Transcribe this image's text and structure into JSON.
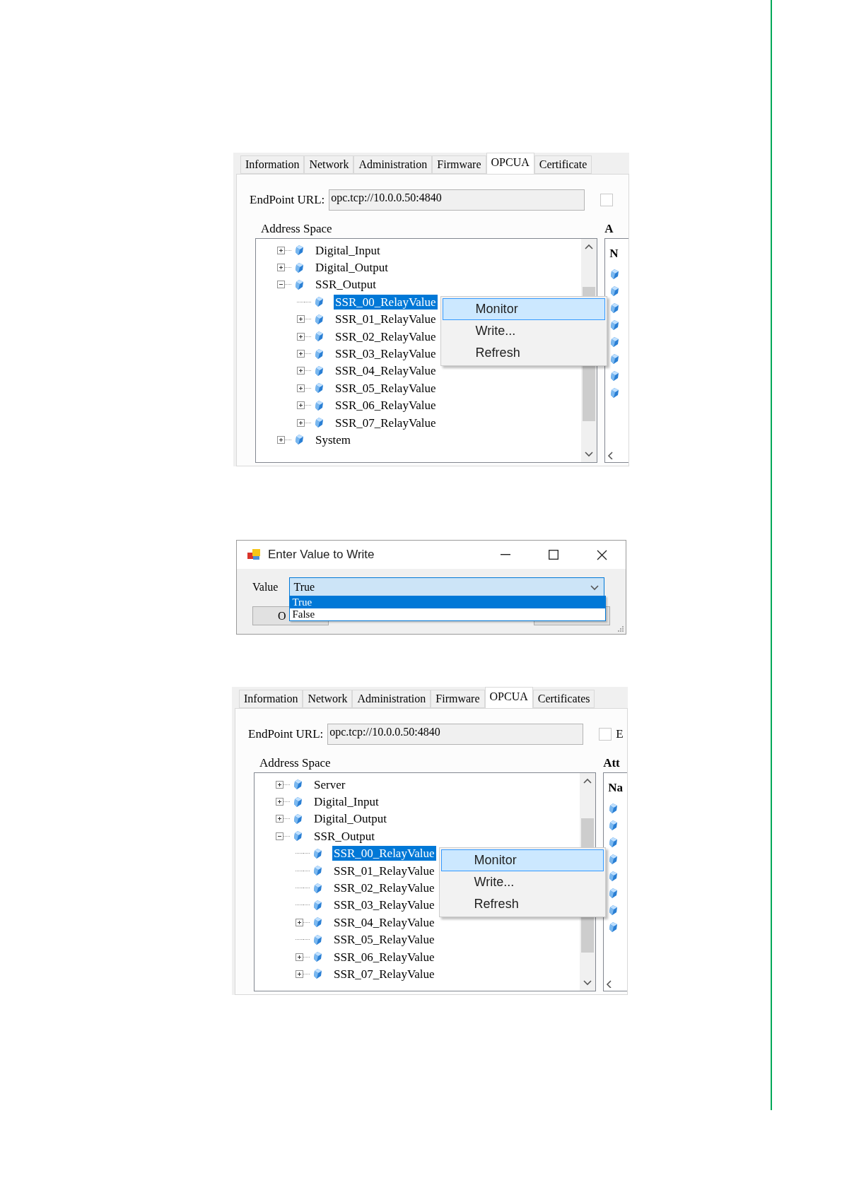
{
  "panels": [
    {
      "kind": "opcua",
      "tabs": [
        {
          "label": "Information",
          "selected": false
        },
        {
          "label": "Network",
          "selected": false
        },
        {
          "label": "Administration",
          "selected": false
        },
        {
          "label": "Firmware",
          "selected": false
        },
        {
          "label": "OPCUA",
          "selected": true
        },
        {
          "label": "Certificate",
          "selected": false
        }
      ],
      "endpoint_label": "EndPoint URL:",
      "endpoint_value": "opc.tcp://10.0.0.50:4840",
      "checkbox_checked": false,
      "address_space_title": "Address Space",
      "attributes_title": "A",
      "attributes_header": "N",
      "tree": [
        {
          "label": "Digital_Input",
          "kind": "collapsed",
          "selected": false
        },
        {
          "label": "Digital_Output",
          "kind": "collapsed",
          "selected": false
        },
        {
          "label": "SSR_Output",
          "kind": "expanded",
          "selected": false,
          "children": [
            {
              "label": "SSR_00_RelayValue",
              "kind": "leaf",
              "selected": true
            },
            {
              "label": "SSR_01_RelayValue",
              "kind": "collapsed",
              "selected": false
            },
            {
              "label": "SSR_02_RelayValue",
              "kind": "collapsed",
              "selected": false
            },
            {
              "label": "SSR_03_RelayValue",
              "kind": "collapsed",
              "selected": false
            },
            {
              "label": "SSR_04_RelayValue",
              "kind": "collapsed",
              "selected": false
            },
            {
              "label": "SSR_05_RelayValue",
              "kind": "collapsed",
              "selected": false
            },
            {
              "label": "SSR_06_RelayValue",
              "kind": "collapsed",
              "selected": false
            },
            {
              "label": "SSR_07_RelayValue",
              "kind": "collapsed",
              "selected": false
            }
          ]
        },
        {
          "label": "System",
          "kind": "collapsed",
          "selected": false
        }
      ],
      "context_menu": [
        {
          "label": "Monitor",
          "selected": true
        },
        {
          "label": "Write...",
          "selected": false
        },
        {
          "label": "Refresh",
          "selected": false
        }
      ]
    },
    {
      "kind": "dialog",
      "title": "Enter Value to Write",
      "value_label": "Value",
      "value": "True",
      "options": [
        {
          "label": "True",
          "selected": true
        },
        {
          "label": "False",
          "selected": false
        }
      ],
      "ok_button": "O"
    },
    {
      "kind": "opcua",
      "tabs": [
        {
          "label": "Information",
          "selected": false
        },
        {
          "label": "Network",
          "selected": false
        },
        {
          "label": "Administration",
          "selected": false
        },
        {
          "label": "Firmware",
          "selected": false
        },
        {
          "label": "OPCUA",
          "selected": true
        },
        {
          "label": "Certificates",
          "selected": false
        }
      ],
      "endpoint_label": "EndPoint URL:",
      "endpoint_value": "opc.tcp://10.0.0.50:4840",
      "checkbox_checked": false,
      "checkbox_label": "E",
      "address_space_title": "Address Space",
      "attributes_title": "Att",
      "attributes_header": "Na",
      "tree": [
        {
          "label": "Server",
          "kind": "collapsed",
          "selected": false
        },
        {
          "label": "Digital_Input",
          "kind": "collapsed",
          "selected": false
        },
        {
          "label": "Digital_Output",
          "kind": "collapsed",
          "selected": false
        },
        {
          "label": "SSR_Output",
          "kind": "expanded",
          "selected": false,
          "children": [
            {
              "label": "SSR_00_RelayValue",
              "kind": "leaf",
              "selected": true
            },
            {
              "label": "SSR_01_RelayValue",
              "kind": "leaf",
              "selected": false
            },
            {
              "label": "SSR_02_RelayValue",
              "kind": "leaf",
              "selected": false
            },
            {
              "label": "SSR_03_RelayValue",
              "kind": "leaf",
              "selected": false
            },
            {
              "label": "SSR_04_RelayValue",
              "kind": "collapsed",
              "selected": false
            },
            {
              "label": "SSR_05_RelayValue",
              "kind": "leaf",
              "selected": false
            },
            {
              "label": "SSR_06_RelayValue",
              "kind": "collapsed",
              "selected": false
            },
            {
              "label": "SSR_07_RelayValue",
              "kind": "collapsed",
              "selected": false
            }
          ]
        }
      ],
      "context_menu": [
        {
          "label": "Monitor",
          "selected": true
        },
        {
          "label": "Write...",
          "selected": false
        },
        {
          "label": "Refresh",
          "selected": false
        }
      ]
    }
  ]
}
